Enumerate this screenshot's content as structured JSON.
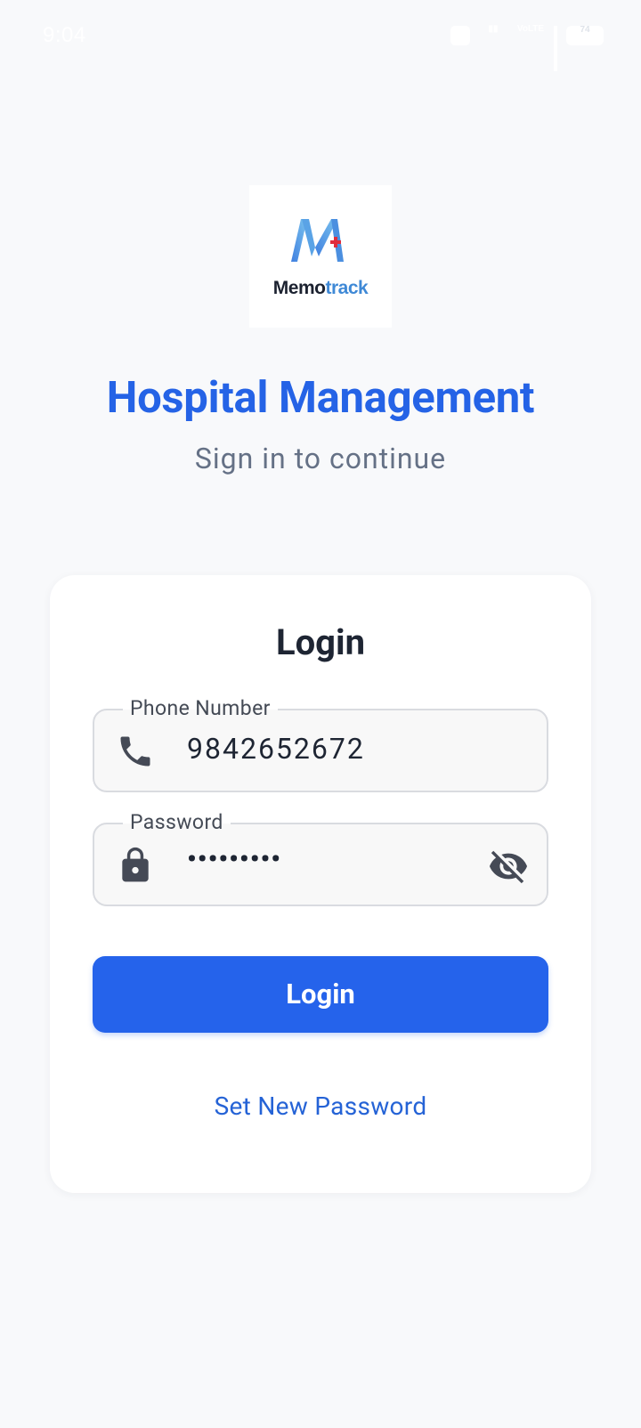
{
  "status_bar": {
    "time": "9:04",
    "battery": "74",
    "network": "VoLTE"
  },
  "logo": {
    "word_part1": "Memo",
    "word_part2": "track",
    "mark_icon": "memotrack-m-cross-icon"
  },
  "header": {
    "title": "Hospital Management",
    "subtitle": "Sign in to continue"
  },
  "login_form": {
    "title": "Login",
    "phone": {
      "label": "Phone Number",
      "value": "9842652672",
      "icon": "phone-icon"
    },
    "password": {
      "label": "Password",
      "value": "•••••••••",
      "icon": "lock-icon",
      "toggle_icon": "visibility-off-icon"
    },
    "submit_label": "Login",
    "reset_link": "Set New Password"
  },
  "colors": {
    "primary": "#2563eb",
    "title_blue": "#2563e6",
    "background": "#f8f9fb",
    "card": "#ffffff"
  }
}
